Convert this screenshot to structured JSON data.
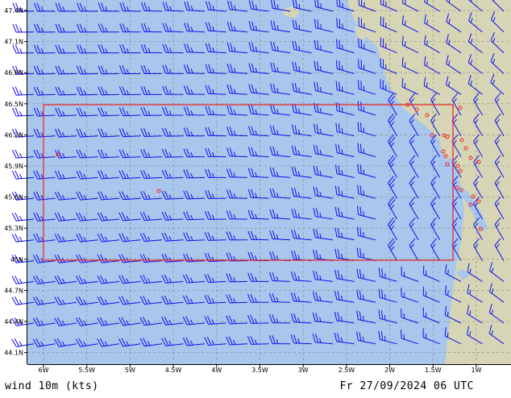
{
  "footer": {
    "variable_label": "wind 10m (kts)",
    "timestamp": "Fr 27/09/2024 06 UTC"
  },
  "axes": {
    "lat_labels": [
      "47.4N",
      "47.1N",
      "46.8N",
      "46.5N",
      "46.2N",
      "45.9N",
      "45.6N",
      "45.3N",
      "45N",
      "44.7N",
      "44.4N",
      "44.1N"
    ],
    "lon_labels": [
      "6W",
      "5.5W",
      "5W",
      "4.5W",
      "4W",
      "3.5W",
      "3W",
      "2.5W",
      "2W",
      "1.5W",
      "1W"
    ]
  },
  "colors": {
    "sea": "#a9c6ec",
    "land": "#d6d5b5",
    "barb": "#1010ee",
    "box": "#ee2222",
    "grid": "#888888"
  },
  "wind_pattern": {
    "direction": "westerly to north-westerly, turning to southerly near coast",
    "typical_speed_kts": 25
  }
}
